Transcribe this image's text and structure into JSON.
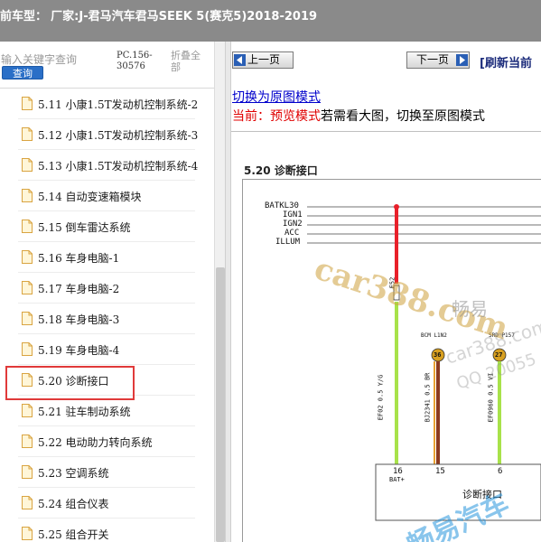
{
  "header": {
    "title_prefix": "前车型：",
    "title": "厂家:J-君马汽车君马SEEK 5(赛克5)2018-2019"
  },
  "sidebar": {
    "search_placeholder": "输入关键字查询",
    "search_button": "查询",
    "code": "PC.156-30576",
    "collapse_all": "折叠全部",
    "items": [
      {
        "label": "5.11 小康1.5T发动机控制系统-2"
      },
      {
        "label": "5.12 小康1.5T发动机控制系统-3"
      },
      {
        "label": "5.13 小康1.5T发动机控制系统-4"
      },
      {
        "label": "5.14 自动变速箱模块"
      },
      {
        "label": "5.15 倒车雷达系统"
      },
      {
        "label": "5.16 车身电脑-1"
      },
      {
        "label": "5.17 车身电脑-2"
      },
      {
        "label": "5.18 车身电脑-3"
      },
      {
        "label": "5.19 车身电脑-4"
      },
      {
        "label": "5.20 诊断接口"
      },
      {
        "label": "5.21 驻车制动系统"
      },
      {
        "label": "5.22 电动助力转向系统"
      },
      {
        "label": "5.23 空调系统"
      },
      {
        "label": "5.24 组合仪表"
      },
      {
        "label": "5.25 组合开关"
      }
    ],
    "selected_index": 9
  },
  "content": {
    "prev_button": "上一页",
    "next_button": "下一页",
    "refresh_link": "[刷新当前",
    "switch_link": "切换为原图模式",
    "mode_prefix": "当前：",
    "mode_current": "预览模式",
    "mode_suffix": "若需看大图，切换至原图模式",
    "diagram": {
      "title": "5.20 诊断接口",
      "power_signals": [
        "BATKL30",
        "IGN1",
        "IGN2",
        "ACC",
        "ILLUM"
      ],
      "fuse_label": "F52",
      "connector_1": "BCM L1N2",
      "connector_2": "SRD P157",
      "node_1": "36",
      "node_2": "27",
      "wire_1": "EF02 0.5 Y/G",
      "wire_2": "BJ2341 0.5 BR",
      "wire_3": "EF0960 0.5 VI",
      "pins": [
        "16",
        "15",
        "6"
      ],
      "pin_desc_1": "BAT+",
      "module_label": "诊断接口",
      "wire_colors": {
        "red": "#e8202a",
        "green": "#a8e24a",
        "brown": "#8b3a1e",
        "orange": "#d8a020"
      }
    },
    "watermarks": [
      "car388.com",
      "畅易",
      "car388.com",
      "QQ 20055",
      "畅易汽车"
    ]
  },
  "colors": {
    "topbar": "#8a8a8a",
    "search_button": "#2a6fc7",
    "highlight": "#e03a3a",
    "link": "#0000cc",
    "mode_red": "#e00000"
  }
}
